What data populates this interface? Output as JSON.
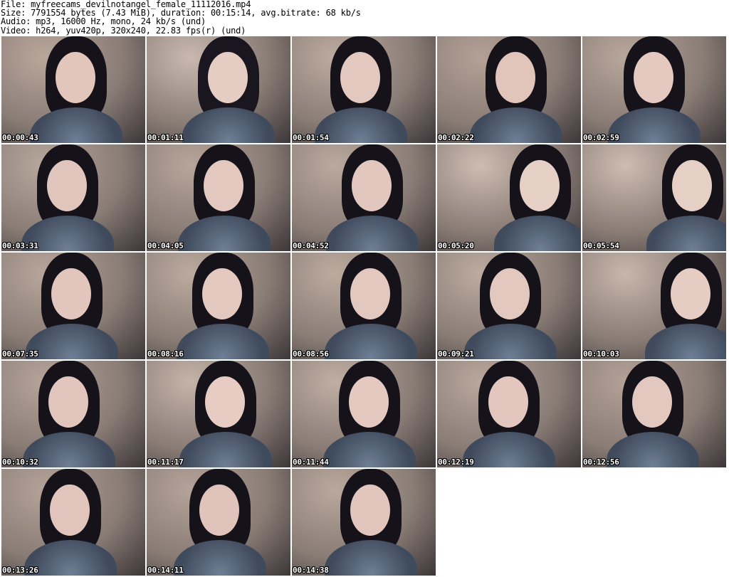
{
  "header": {
    "file_line": "File: myfreecams_devilnotangel_female_11112016.mp4",
    "size_line": "Size: 7791554 bytes (7.43 MiB), duration: 00:15:14, avg.bitrate: 68 kb/s",
    "audio_line": "Audio: mp3, 16000 Hz, mono, 24 kb/s (und)",
    "video_line": "Video: h264, yuv420p, 320x240, 22.83 fps(r) (und)"
  },
  "thumbnails": [
    {
      "timestamp": "00:00:43",
      "tone": "#b9a79b",
      "skin": "#e3c6bb",
      "hair": "#15121a"
    },
    {
      "timestamp": "00:01:11",
      "tone": "#c9b9b0",
      "skin": "#e6cdc4",
      "hair": "#1a1620"
    },
    {
      "timestamp": "00:01:54",
      "tone": "#bcab9f",
      "skin": "#e2c8bf",
      "hair": "#15121a"
    },
    {
      "timestamp": "00:02:22",
      "tone": "#b3a196",
      "skin": "#e1c4ba",
      "hair": "#15121a"
    },
    {
      "timestamp": "00:02:59",
      "tone": "#b8a79c",
      "skin": "#e4c9c0",
      "hair": "#15121a"
    },
    {
      "timestamp": "00:03:31",
      "tone": "#b8a89d",
      "skin": "#e0c5bc",
      "hair": "#15121a"
    },
    {
      "timestamp": "00:04:05",
      "tone": "#b6a59a",
      "skin": "#e3c8bf",
      "hair": "#15121a"
    },
    {
      "timestamp": "00:04:52",
      "tone": "#baa99e",
      "skin": "#e2c7be",
      "hair": "#15121a"
    },
    {
      "timestamp": "00:05:20",
      "tone": "#cdbcb1",
      "skin": "#e6d0c6",
      "hair": "#15121a"
    },
    {
      "timestamp": "00:05:54",
      "tone": "#cdbcb1",
      "skin": "#e6d0c6",
      "hair": "#15121a"
    },
    {
      "timestamp": "00:07:35",
      "tone": "#b7a69b",
      "skin": "#e2c6bd",
      "hair": "#15121a"
    },
    {
      "timestamp": "00:08:16",
      "tone": "#bbaa9f",
      "skin": "#e4c9c0",
      "hair": "#15121a"
    },
    {
      "timestamp": "00:08:56",
      "tone": "#bcab9f",
      "skin": "#e3c8bf",
      "hair": "#15121a"
    },
    {
      "timestamp": "00:09:21",
      "tone": "#bcab9f",
      "skin": "#e3c8bf",
      "hair": "#15121a"
    },
    {
      "timestamp": "00:10:03",
      "tone": "#c7b6ab",
      "skin": "#e5cdc3",
      "hair": "#15121a"
    },
    {
      "timestamp": "00:10:32",
      "tone": "#b5a49a",
      "skin": "#e2c6bd",
      "hair": "#15121a"
    },
    {
      "timestamp": "00:11:17",
      "tone": "#c4b3a8",
      "skin": "#e6ccc3",
      "hair": "#15121a"
    },
    {
      "timestamp": "00:11:44",
      "tone": "#bfae a3",
      "skin": "#e4c9c0",
      "hair": "#15121a"
    },
    {
      "timestamp": "00:12:19",
      "tone": "#b8a79c",
      "skin": "#e3c7be",
      "hair": "#15121a"
    },
    {
      "timestamp": "00:12:56",
      "tone": "#b2a197",
      "skin": "#e3c8bf",
      "hair": "#15121a"
    },
    {
      "timestamp": "00:13:26",
      "tone": "#b3a298",
      "skin": "#e1c5bc",
      "hair": "#15121a"
    },
    {
      "timestamp": "00:14:11",
      "tone": "#b4a399",
      "skin": "#e0c4bb",
      "hair": "#15121a"
    },
    {
      "timestamp": "00:14:38",
      "tone": "#b9a89d",
      "skin": "#e2c6bd",
      "hair": "#15121a"
    }
  ]
}
